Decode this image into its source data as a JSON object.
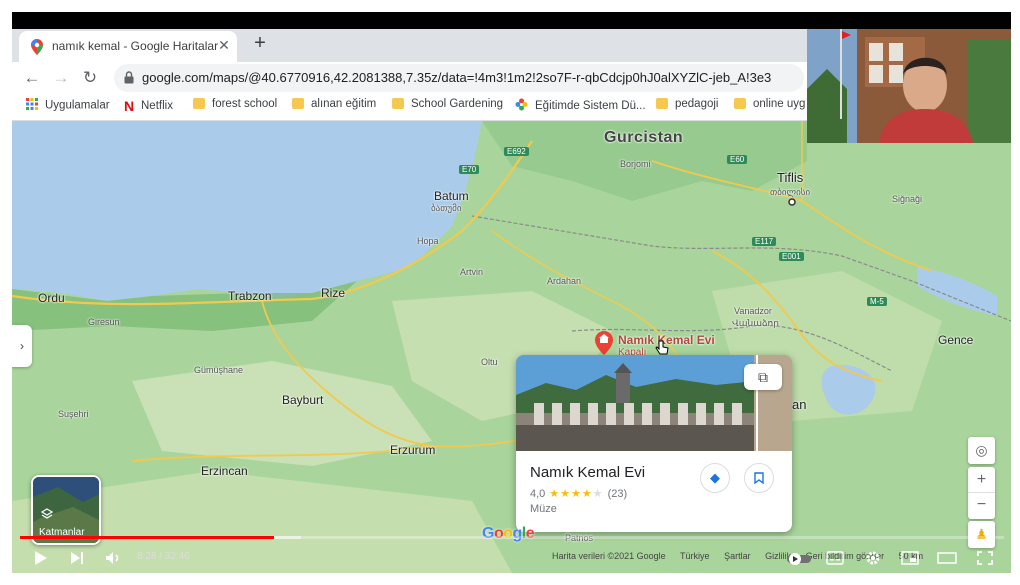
{
  "browser": {
    "tab_title": "namık kemal - Google Haritalar",
    "url": "google.com/maps/@40.6770916,42.2081388,7.35z/data=!4m3!1m2!2so7F-r-qbCdcjp0hJ0alXYZlC-jeb_A!3e3",
    "bookmarks": [
      {
        "label": "Uygulamalar",
        "icon": "apps-grid-icon"
      },
      {
        "label": "Netflix",
        "icon": "netflix-icon"
      },
      {
        "label": "forest school",
        "icon": "folder-icon"
      },
      {
        "label": "alınan eğitim",
        "icon": "folder-icon"
      },
      {
        "label": "School Gardening",
        "icon": "folder-icon"
      },
      {
        "label": "Eğitimde Sistem Dü...",
        "icon": "flower-icon"
      },
      {
        "label": "pedagoji",
        "icon": "folder-icon"
      },
      {
        "label": "online uyg",
        "icon": "folder-icon"
      }
    ]
  },
  "map": {
    "labels": {
      "gurcistan": "Gurcistan",
      "batum": "Batum",
      "batum_local": "ბათუმი",
      "tiflis": "Tiflis",
      "tiflis_local": "თბილისი",
      "borjomi": "Borjomi",
      "signagi": "Siğnaği",
      "rize": "Rize",
      "trabzon": "Trabzon",
      "ordu": "Ordu",
      "giresun": "Giresun",
      "gumushane": "Gümüşhane",
      "bayburt": "Bayburt",
      "erzurum": "Erzurum",
      "erzincan": "Erzincan",
      "ardahan": "Ardahan",
      "artvin": "Artvin",
      "oltu": "Oltu",
      "vanadzor": "Vanadzor",
      "vanadzor_local": "Վանաձոր",
      "gence": "Gence",
      "susehri": "Suşehri",
      "hopa": "Hopa",
      "an_partial": "an",
      "patnos": "Patnos"
    },
    "road_shields": [
      "E692",
      "E70",
      "E60",
      "E117",
      "E001",
      "M-5"
    ],
    "poi": {
      "name": "Namık Kemal Evi",
      "subtitle": "Kapalı"
    },
    "card": {
      "name": "Namık Kemal Evi",
      "rating": "4,0",
      "stars_filled": 4,
      "reviews": "(23)",
      "category": "Müze"
    },
    "layers_label": "Katmanlar",
    "google_logo": "Google",
    "attribution": [
      "Harita verileri ©2021 Google",
      "Türkiye",
      "Şartlar",
      "Gizlilik",
      "Geri bildirim gönder",
      "50 km"
    ]
  },
  "player": {
    "time": "8:28 / 32:46",
    "progress": 0.258
  },
  "colors": {
    "sea": "#aacbe9",
    "land": "#a8d49a",
    "accent_red": "#ff0000",
    "poi_red": "#ea4335"
  }
}
